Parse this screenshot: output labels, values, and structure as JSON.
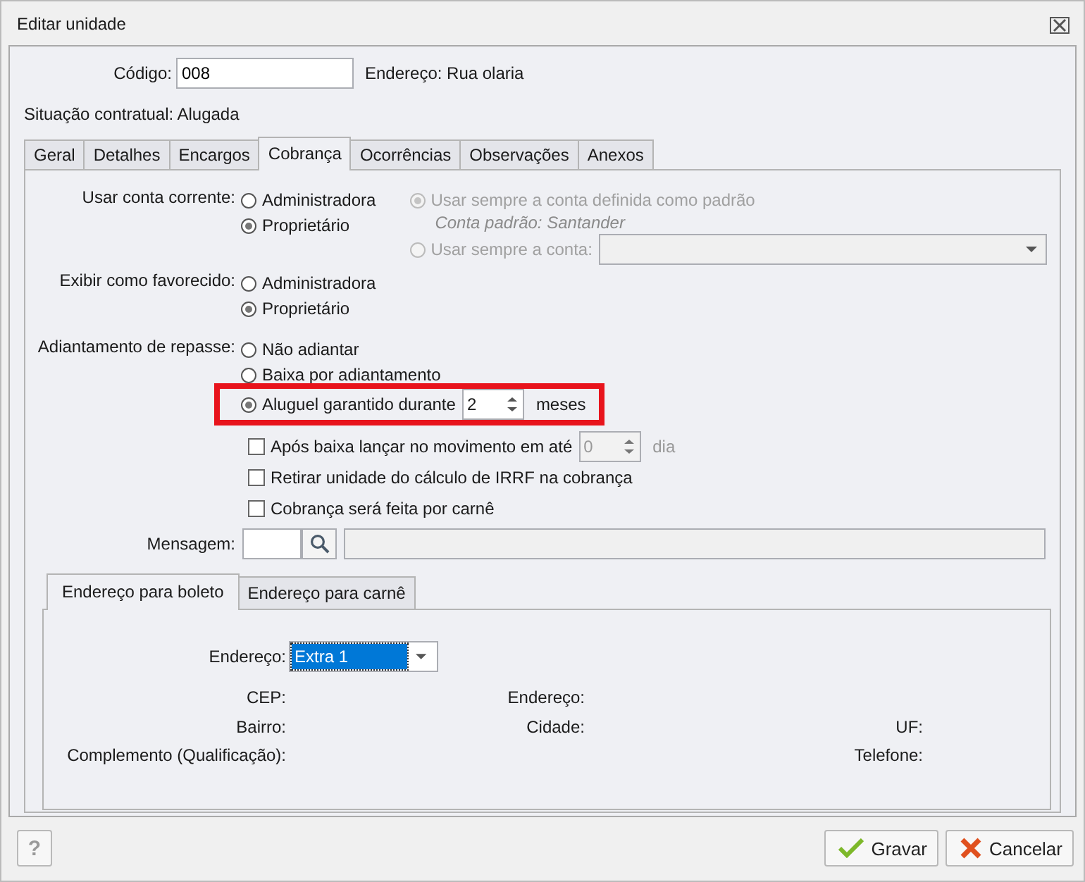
{
  "window": {
    "title": "Editar unidade"
  },
  "codigo": {
    "label": "Código:",
    "value": "008"
  },
  "endereco_info": "Endereço: Rua olaria",
  "situacao": "Situação contratual: Alugada",
  "tabs": [
    {
      "label": "Geral",
      "selected": false
    },
    {
      "label": "Detalhes",
      "selected": false
    },
    {
      "label": "Encargos",
      "selected": false
    },
    {
      "label": "Cobrança",
      "selected": true
    },
    {
      "label": "Ocorrências",
      "selected": false
    },
    {
      "label": "Observações",
      "selected": false
    },
    {
      "label": "Anexos",
      "selected": false
    }
  ],
  "usar_conta_corrente": {
    "label": "Usar conta corrente:",
    "options": [
      {
        "label": "Administradora",
        "selected": false
      },
      {
        "label": "Proprietário",
        "selected": true
      }
    ]
  },
  "conta_opcoes": [
    {
      "kind": "note",
      "label": "Usar sempre a conta definida como padrão",
      "selected": true,
      "disabled": true,
      "note": "Conta padrão: Santander"
    },
    {
      "kind": "dropdown",
      "label": "Usar sempre a conta:",
      "selected": false,
      "disabled": true
    }
  ],
  "exibir_favorecido": {
    "label": "Exibir como favorecido:",
    "options": [
      {
        "label": "Administradora",
        "selected": false
      },
      {
        "label": "Proprietário",
        "selected": true
      }
    ]
  },
  "adiantamento": {
    "label": "Adiantamento de repasse:",
    "options": [
      {
        "kind": "plain",
        "label": "Não adiantar",
        "selected": false
      },
      {
        "kind": "plain",
        "label": "Baixa por adiantamento",
        "selected": false
      },
      {
        "kind": "spin",
        "label": "Aluguel garantido durante",
        "selected": true,
        "value": "2",
        "unit": "meses",
        "highlighted": true
      }
    ]
  },
  "checkboxes": [
    {
      "kind": "spin",
      "label": "Após baixa lançar no movimento em até",
      "checked": false,
      "value": "0",
      "unit": "dia"
    },
    {
      "kind": "plain",
      "label": "Retirar unidade do cálculo de IRRF na cobrança",
      "checked": false
    },
    {
      "kind": "plain",
      "label": "Cobrança será feita por carnê",
      "checked": false
    }
  ],
  "mensagem": {
    "label": "Mensagem:"
  },
  "sub_tabs": [
    {
      "label": "Endereço para boleto",
      "selected": true
    },
    {
      "label": "Endereço para carnê",
      "selected": false
    }
  ],
  "endereco_select": {
    "label": "Endereço:",
    "value": "Extra 1"
  },
  "address_rows": [
    [
      "CEP:",
      "Endereço:",
      null
    ],
    [
      "Bairro:",
      "Cidade:",
      "UF:"
    ],
    [
      "Complemento (Qualificação):",
      null,
      "Telefone:"
    ]
  ],
  "help_button": "?",
  "buttons": [
    {
      "kind": "save",
      "label": "Gravar"
    },
    {
      "kind": "cancel",
      "label": "Cancelar"
    }
  ]
}
